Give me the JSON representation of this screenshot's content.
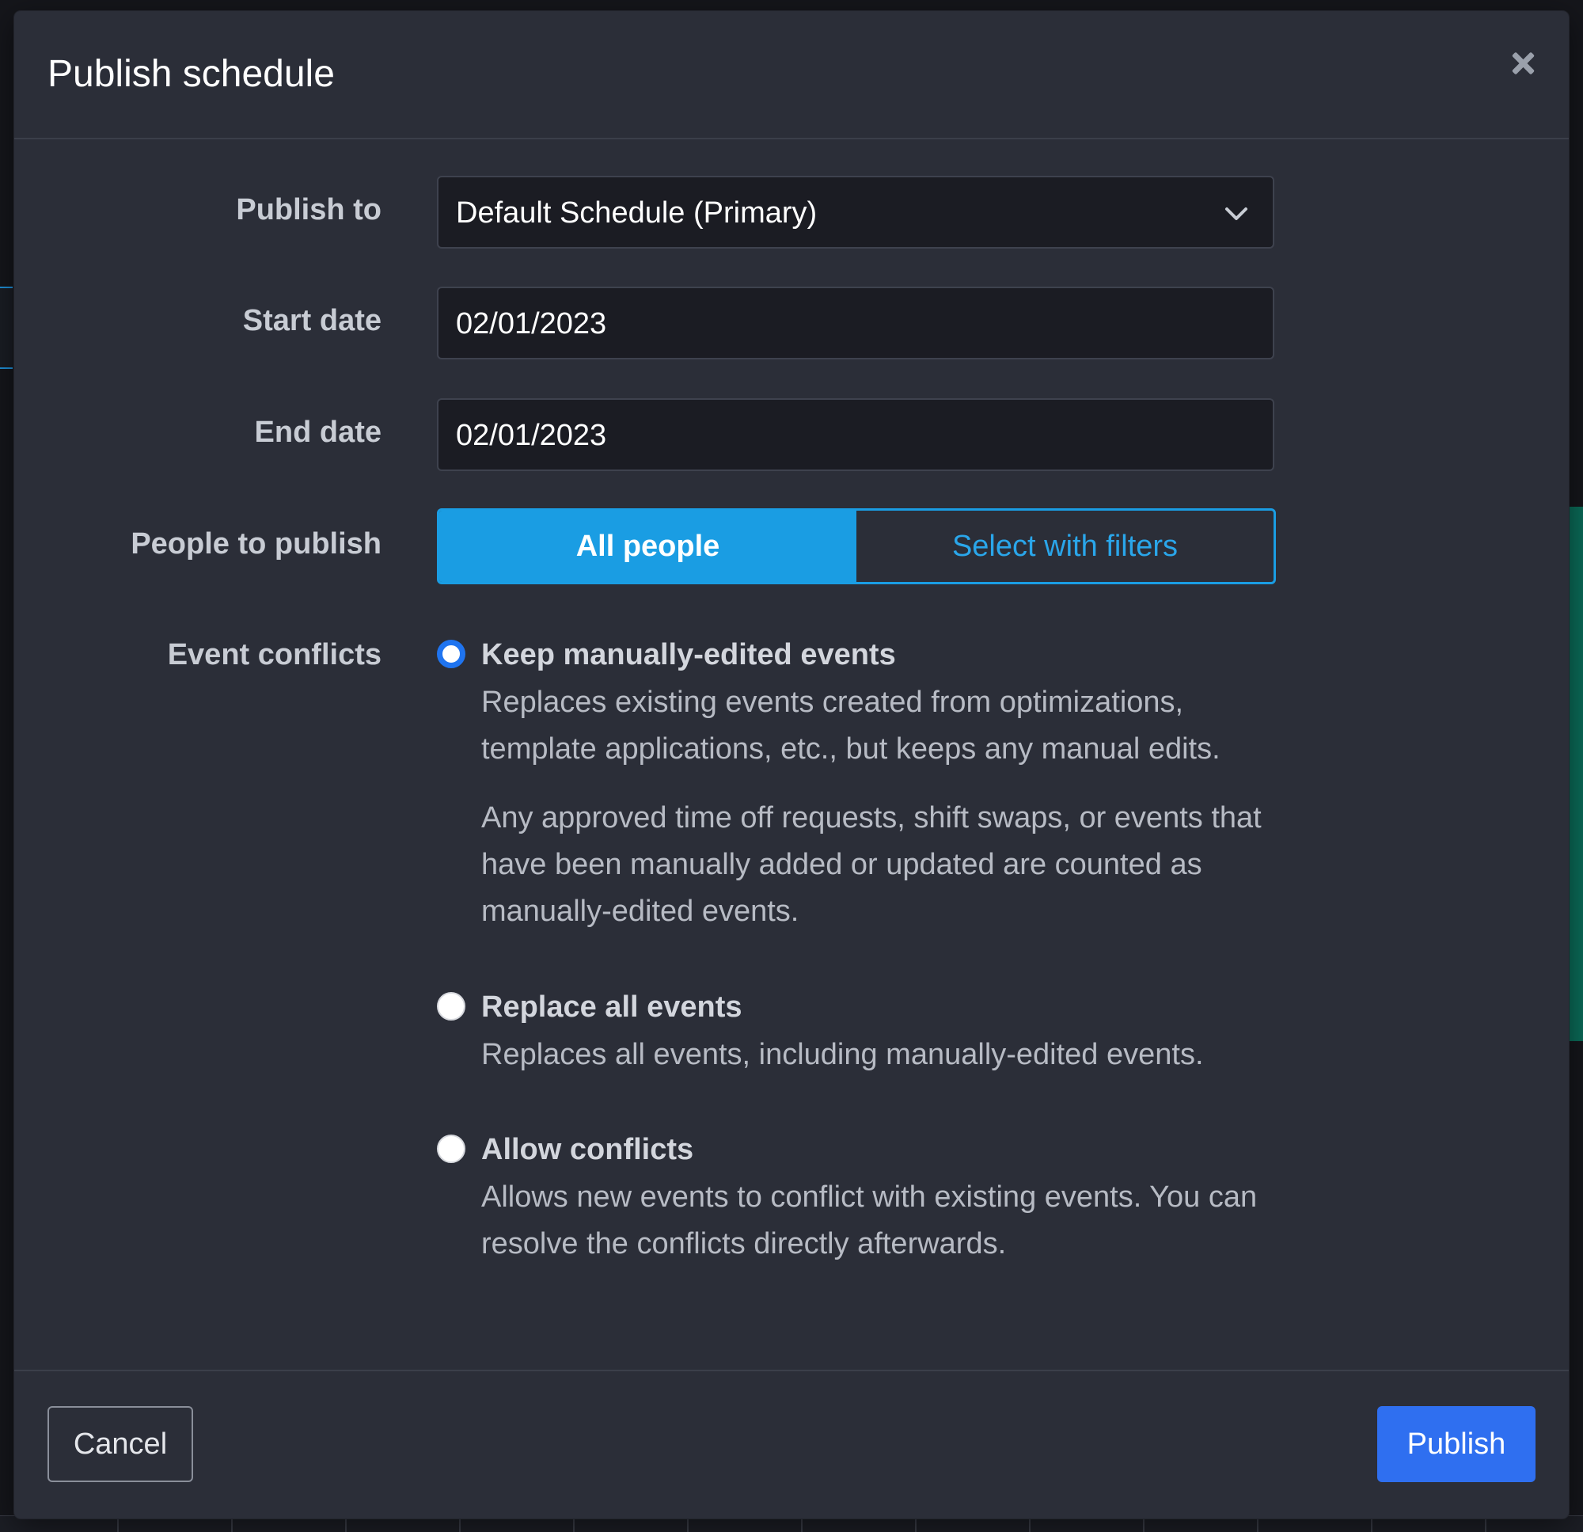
{
  "modal": {
    "title": "Publish schedule",
    "close_icon": "close-icon"
  },
  "form": {
    "publish_to": {
      "label": "Publish to",
      "value": "Default Schedule (Primary)",
      "icon": "chevron-down-icon"
    },
    "start_date": {
      "label": "Start date",
      "value": "02/01/2023"
    },
    "end_date": {
      "label": "End date",
      "value": "02/01/2023"
    },
    "people_to_publish": {
      "label": "People to publish",
      "options": [
        "All people",
        "Select with filters"
      ],
      "selected": "All people"
    },
    "event_conflicts": {
      "label": "Event conflicts",
      "selected": "Keep manually-edited events",
      "options": [
        {
          "title": "Keep manually-edited events",
          "description": "Replaces existing events created from optimizations, template applications, etc., but keeps any manual edits.",
          "note": "Any approved time off requests, shift swaps, or events that have been manually added or updated are counted as manually-edited events."
        },
        {
          "title": "Replace all events",
          "description": "Replaces all events, including manually-edited events."
        },
        {
          "title": "Allow conflicts",
          "description": "Allows new events to conflict with existing events. You can resolve the conflicts directly afterwards."
        }
      ]
    }
  },
  "footer": {
    "cancel_label": "Cancel",
    "publish_label": "Publish"
  },
  "colors": {
    "modal_bg": "#2b2e38",
    "accent": "#1a9de3",
    "primary_button": "#2f6ff0",
    "radio_checked": "#1f74f0"
  }
}
